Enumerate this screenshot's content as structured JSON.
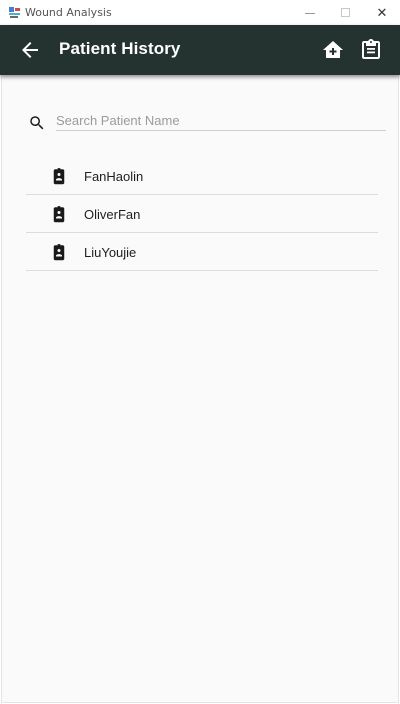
{
  "window": {
    "title": "Wound Analysis",
    "app_icon": "wound-analysis-app-icon",
    "controls": {
      "minimize_icon": "minimize-icon",
      "maximize_icon": "maximize-icon",
      "close_icon": "close-icon",
      "close_glyph": "✕"
    }
  },
  "appbar": {
    "title": "Patient History",
    "background": "#243330",
    "back_icon": "arrow-back-icon",
    "actions": [
      {
        "icon": "home-add-icon"
      },
      {
        "icon": "clipboard-icon"
      }
    ]
  },
  "search": {
    "placeholder": "Search Patient Name",
    "value": "",
    "icon": "search-icon"
  },
  "patients": [
    {
      "name": "FanHaolin",
      "icon": "id-badge-icon"
    },
    {
      "name": "OliverFan",
      "icon": "id-badge-icon"
    },
    {
      "name": "LiuYoujie",
      "icon": "id-badge-icon"
    }
  ]
}
